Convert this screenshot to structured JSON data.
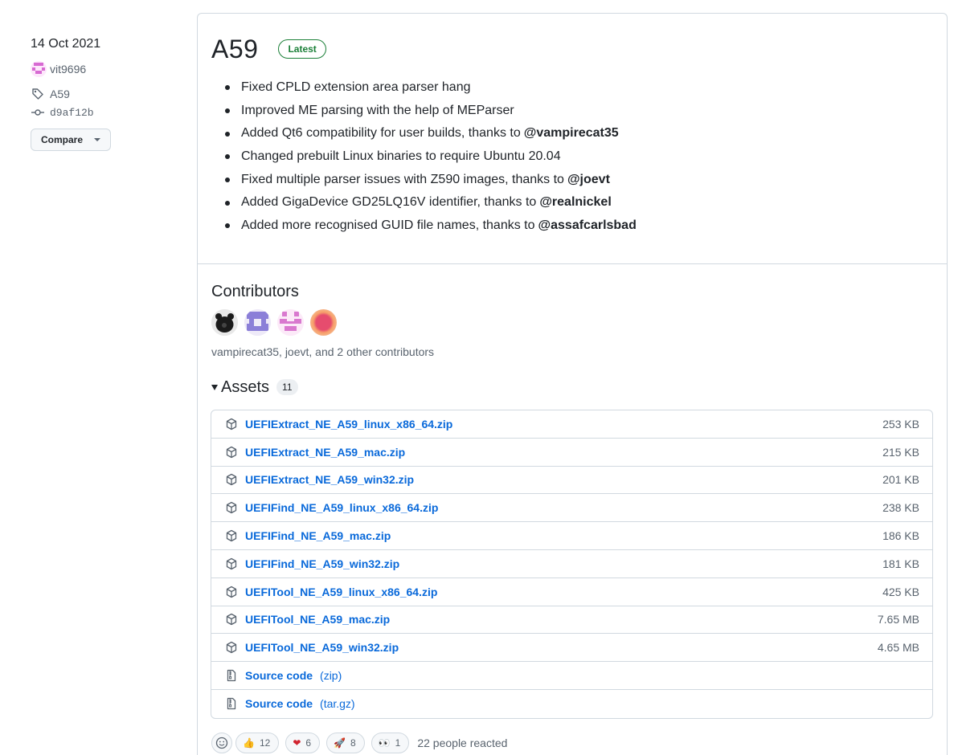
{
  "meta": {
    "date": "14 Oct 2021",
    "author": "vit9696",
    "tag": "A59",
    "commit": "d9af12b",
    "compare_label": "Compare"
  },
  "release": {
    "title": "A59",
    "badge": "Latest",
    "notes": [
      {
        "text": "Fixed CPLD extension area parser hang",
        "mention": ""
      },
      {
        "text": "Improved ME parsing with the help of MEParser",
        "mention": ""
      },
      {
        "text": "Added Qt6 compatibility for user builds, thanks to",
        "mention": "@vampirecat35"
      },
      {
        "text": "Changed prebuilt Linux binaries to require Ubuntu 20.04",
        "mention": ""
      },
      {
        "text": "Fixed multiple parser issues with Z590 images, thanks to",
        "mention": "@joevt"
      },
      {
        "text": "Added GigaDevice GD25LQ16V identifier, thanks to",
        "mention": "@realnickel"
      },
      {
        "text": "Added more recognised GUID file names, thanks to",
        "mention": "@assafcarlsbad"
      }
    ]
  },
  "contributors": {
    "heading": "Contributors",
    "summary": "vampirecat35, joevt, and 2 other contributors"
  },
  "assets": {
    "heading": "Assets",
    "count": "11",
    "files": [
      {
        "name": "UEFIExtract_NE_A59_linux_x86_64.zip",
        "size": "253 KB"
      },
      {
        "name": "UEFIExtract_NE_A59_mac.zip",
        "size": "215 KB"
      },
      {
        "name": "UEFIExtract_NE_A59_win32.zip",
        "size": "201 KB"
      },
      {
        "name": "UEFIFind_NE_A59_linux_x86_64.zip",
        "size": "238 KB"
      },
      {
        "name": "UEFIFind_NE_A59_mac.zip",
        "size": "186 KB"
      },
      {
        "name": "UEFIFind_NE_A59_win32.zip",
        "size": "181 KB"
      },
      {
        "name": "UEFITool_NE_A59_linux_x86_64.zip",
        "size": "425 KB"
      },
      {
        "name": "UEFITool_NE_A59_mac.zip",
        "size": "7.65 MB"
      },
      {
        "name": "UEFITool_NE_A59_win32.zip",
        "size": "4.65 MB"
      }
    ],
    "source": [
      {
        "name": "Source code",
        "ext": "(zip)"
      },
      {
        "name": "Source code",
        "ext": "(tar.gz)"
      }
    ]
  },
  "reactions": {
    "items": [
      {
        "emoji": "👍",
        "count": "12"
      },
      {
        "emoji": "❤",
        "count": "6"
      },
      {
        "emoji": "🚀",
        "count": "8"
      },
      {
        "emoji": "👀",
        "count": "1"
      }
    ],
    "summary": "22 people reacted"
  }
}
